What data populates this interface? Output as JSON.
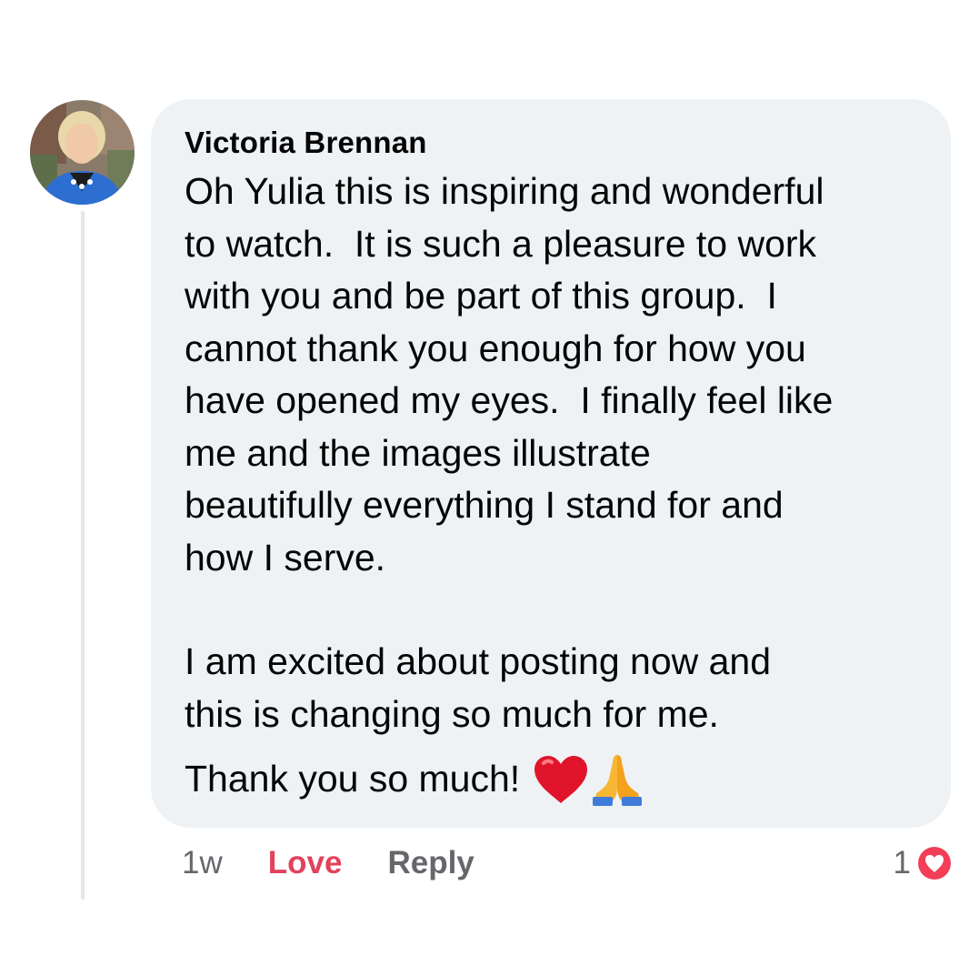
{
  "comment": {
    "author": "Victoria Brennan",
    "paragraphs": [
      "Oh Yulia this is inspiring and wonderful\nto watch.  It is such a pleasure to work\nwith you and be part of this group.  I\ncannot thank you enough for how you\nhave opened my eyes.  I finally feel like\nme and the images illustrate\nbeautifully everything I stand for and\nhow I serve.",
      "I am excited about posting now and\nthis is changing so much for me.",
      "Thank you so much!"
    ],
    "emojis": [
      "heart-emoji",
      "folded-hands-emoji"
    ],
    "timestamp": "1w",
    "love_label": "Love",
    "reply_label": "Reply",
    "reaction_count": "1",
    "reaction_icon": "love-reaction-icon",
    "colors": {
      "bubble": "#eff2f5",
      "love": "#e3425c",
      "meta": "#65676b"
    }
  }
}
